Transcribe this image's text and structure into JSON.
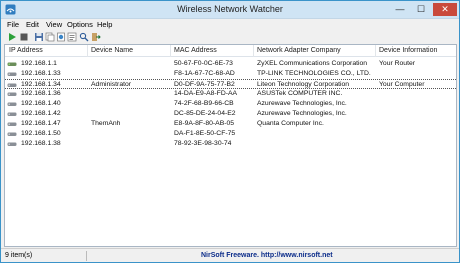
{
  "window": {
    "title": "Wireless Network Watcher",
    "minimize_glyph": "—",
    "maximize_glyph": "☐",
    "close_glyph": "✕"
  },
  "menu": [
    "File",
    "Edit",
    "View",
    "Options",
    "Help"
  ],
  "toolbar": {
    "icons": [
      "play-icon",
      "stop-icon",
      "save-icon",
      "copy-icon",
      "html-report-icon",
      "properties-icon",
      "find-icon",
      "exit-icon"
    ]
  },
  "columns": [
    "IP Address",
    "Device Name",
    "MAC Address",
    "Network Adapter Company",
    "Device Information"
  ],
  "rows": [
    {
      "ip": "192.168.1.1",
      "device": "",
      "mac": "50-67-F0-0C-6E-73",
      "company": "ZyXEL Communications Corporation",
      "info": "Your Router",
      "icon": "router"
    },
    {
      "ip": "192.168.1.33",
      "device": "",
      "mac": "F8-1A-67-7C-68-AD",
      "company": "TP-LINK TECHNOLOGIES CO., LTD.",
      "info": "",
      "icon": "device"
    },
    {
      "ip": "192.168.1.34",
      "device": "Administrator",
      "mac": "D0-DF-9A-75-77-B2",
      "company": "Liteon Technology Corporation",
      "info": "Your Computer",
      "icon": "device",
      "selected": true
    },
    {
      "ip": "192.168.1.36",
      "device": "",
      "mac": "14-DA-E9-A8-FD-AA",
      "company": "ASUSTek COMPUTER INC.",
      "info": "",
      "icon": "device"
    },
    {
      "ip": "192.168.1.40",
      "device": "",
      "mac": "74-2F-68-B9-66-CB",
      "company": "Azurewave Technologies, Inc.",
      "info": "",
      "icon": "device"
    },
    {
      "ip": "192.168.1.42",
      "device": "",
      "mac": "DC-85-DE-24-04-E2",
      "company": "Azurewave Technologies, Inc.",
      "info": "",
      "icon": "device"
    },
    {
      "ip": "192.168.1.47",
      "device": "ThemAnh",
      "mac": "E8-9A-8F-80-AB-05",
      "company": "Quanta Computer Inc.",
      "info": "",
      "icon": "device"
    },
    {
      "ip": "192.168.1.50",
      "device": "",
      "mac": "DA-F1-8E-50-CF-75",
      "company": "",
      "info": "",
      "icon": "device"
    },
    {
      "ip": "192.168.1.38",
      "device": "",
      "mac": "78-92-3E-98-30-74",
      "company": "",
      "info": "",
      "icon": "device"
    }
  ],
  "status": {
    "count": "9 item(s)",
    "credit": "NirSoft Freeware.  http://www.nirsoft.net"
  },
  "colors": {
    "title_bar": "#cfe4f4",
    "close_button": "#c94a3c",
    "credit_text": "#0b2c8a"
  }
}
